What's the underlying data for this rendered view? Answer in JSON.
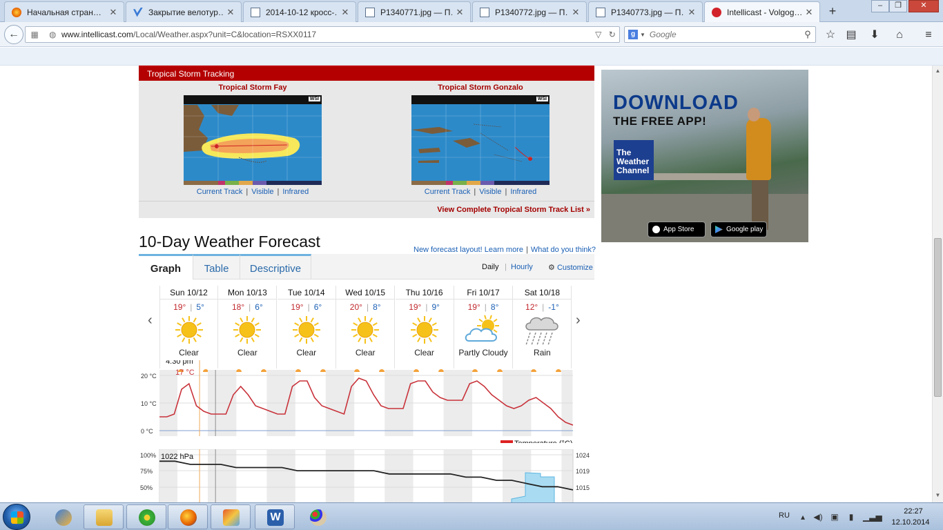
{
  "browser": {
    "tabs": [
      {
        "title": "Начальная стран…",
        "favicon_color": "#e66000"
      },
      {
        "title": "Закрытие велотур…",
        "favicon_color": "#3a7bd5"
      },
      {
        "title": "2014-10-12 кросс-…",
        "favicon_color": "#5a6f8a"
      },
      {
        "title": "P1340771.jpg — П…",
        "favicon_color": "#5a6f8a"
      },
      {
        "title": "P1340772.jpg — П…",
        "favicon_color": "#5a6f8a"
      },
      {
        "title": "P1340773.jpg — П…",
        "favicon_color": "#5a6f8a"
      },
      {
        "title": "Intellicast - Volgog…",
        "favicon_color": "#d2232a"
      }
    ],
    "url_host": "www.intellicast.com",
    "url_path": "/Local/Weather.aspx?unit=C&location=RSXX0117",
    "search_placeholder": "Google",
    "search_engine_letter": "g"
  },
  "storm": {
    "header": "Tropical Storm Tracking",
    "storms": [
      {
        "name": "Tropical Storm Fay",
        "links": [
          "Current Track",
          "Visible",
          "Infrared"
        ]
      },
      {
        "name": "Tropical Storm Gonzalo",
        "links": [
          "Current Track",
          "Visible",
          "Infrared"
        ]
      }
    ],
    "map_badge": "WSI",
    "view_all": "View Complete Tropical Storm Track List »"
  },
  "ad": {
    "headline": "DOWNLOAD",
    "subhead": "THE FREE APP!",
    "brand_line1": "The",
    "brand_line2": "Weather",
    "brand_line3": "Channel",
    "app_store": "App Store",
    "google_play": "Google play"
  },
  "forecast": {
    "title": "10-Day Weather Forecast",
    "new_layout_link": "New forecast layout! Learn more",
    "feedback_link": "What do you think?",
    "tabs": [
      "Graph",
      "Table",
      "Descriptive"
    ],
    "active_tab": "Graph",
    "view_daily": "Daily",
    "view_hourly": "Hourly",
    "customize": "Customize",
    "days": [
      {
        "name": "Sun 10/12",
        "hi": "19°",
        "lo": "5°",
        "cond": "Clear",
        "icon": "sun"
      },
      {
        "name": "Mon 10/13",
        "hi": "18°",
        "lo": "6°",
        "cond": "Clear",
        "icon": "sun"
      },
      {
        "name": "Tue 10/14",
        "hi": "19°",
        "lo": "6°",
        "cond": "Clear",
        "icon": "sun"
      },
      {
        "name": "Wed 10/15",
        "hi": "20°",
        "lo": "8°",
        "cond": "Clear",
        "icon": "sun"
      },
      {
        "name": "Thu 10/16",
        "hi": "19°",
        "lo": "9°",
        "cond": "Clear",
        "icon": "sun"
      },
      {
        "name": "Fri 10/17",
        "hi": "19°",
        "lo": "8°",
        "cond": "Partly Cloudy",
        "icon": "partly-cloudy"
      },
      {
        "name": "Sat 10/18",
        "hi": "12°",
        "lo": "-1°",
        "cond": "Rain",
        "icon": "rain"
      }
    ],
    "now_time": "4:30 pm",
    "now_temp": "17 °C",
    "temp_axis": [
      "20 °C",
      "10 °C",
      "0 °C"
    ],
    "legend_temperature": "Temperature (°C)",
    "pressure_now": "1022 hPa",
    "pct_axis": [
      "100%",
      "75%",
      "50%"
    ],
    "hpa_axis": [
      "1024",
      "1019",
      "1015"
    ],
    "colors": {
      "temp_line": "#c8323a",
      "storm_red": "#b40000",
      "link_blue": "#1a5fb4",
      "sun": "#f6c21a"
    }
  },
  "taskbar": {
    "lang": "RU",
    "time": "22:27",
    "date": "12.10.2014",
    "items": [
      "Thunderbird",
      "File Explorer",
      "ICQ",
      "Firefox",
      "Paint",
      "Word",
      "Paint palette"
    ]
  },
  "chart_data": [
    {
      "type": "line",
      "series": [
        {
          "name": "Temperature (°C)",
          "values": [
            5,
            5,
            6,
            15,
            17,
            9,
            7,
            6,
            6,
            6,
            13,
            16,
            13,
            9,
            8,
            7,
            6,
            6,
            16,
            18,
            18,
            12,
            9,
            8,
            7,
            6,
            16,
            19,
            18,
            13,
            9,
            8,
            8,
            8,
            17,
            18,
            18,
            14,
            12,
            11,
            11,
            11,
            17,
            18,
            16,
            13,
            11,
            9,
            8,
            9,
            11,
            12,
            10,
            8,
            5,
            3,
            2
          ]
        }
      ],
      "xlabel": "",
      "ylabel": "",
      "ylim": [
        -2,
        22
      ],
      "yticks": [
        "20 °C",
        "10 °C",
        "0 °C"
      ],
      "annotations": [
        "4:30 pm",
        "17 °C"
      ]
    },
    {
      "type": "line",
      "series": [
        {
          "name": "",
          "values": [
            1022,
            1022,
            1021,
            1021,
            1021,
            1020,
            1020,
            1020,
            1020,
            1019,
            1019,
            1019,
            1019,
            1019,
            1019,
            1018,
            1018,
            1018,
            1018,
            1018,
            1017,
            1017,
            1016,
            1016,
            1015,
            1014,
            1014,
            1013
          ]
        }
      ],
      "yticks_left": [
        "100%",
        "75%",
        "50%"
      ],
      "yticks_right": [
        "1024",
        "1019",
        "1015"
      ],
      "annotations": [
        "1022 hPa"
      ]
    }
  ]
}
